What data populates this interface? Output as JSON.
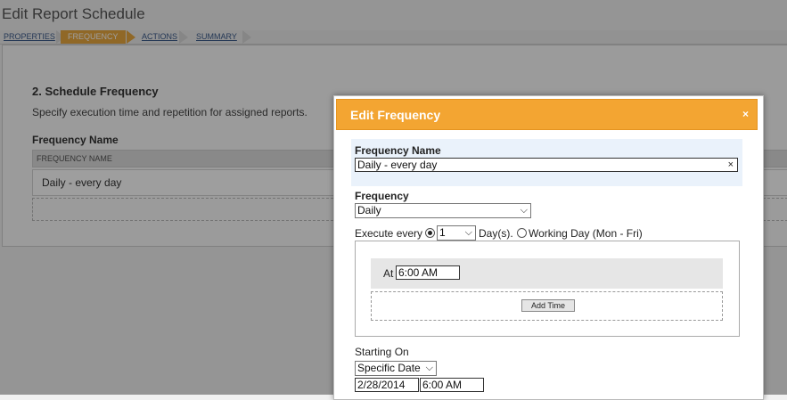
{
  "page": {
    "title": "Edit Report Schedule",
    "steps": [
      "PROPERTIES",
      "FREQUENCY",
      "ACTIONS",
      "SUMMARY"
    ],
    "active_step": "FREQUENCY"
  },
  "background": {
    "section_title": "2. Schedule Frequency",
    "section_description": "Specify execution time and repetition for assigned reports.",
    "frequency_name_label": "Frequency Name",
    "column_header": "FREQUENCY NAME",
    "rows": [
      "Daily - every day"
    ]
  },
  "modal": {
    "title": "Edit Frequency",
    "close_icon": "×",
    "frequency_name_label": "Frequency Name",
    "frequency_name_value": "Daily - every day",
    "clear_icon": "×",
    "frequency_label": "Frequency",
    "frequency_value": "Daily",
    "execute_every_label": "Execute every",
    "execute_every_value": "1",
    "days_label": "Day(s).",
    "working_day_label": "Working Day (Mon - Fri)",
    "execute_every_checked": true,
    "working_day_checked": false,
    "at_label": "At",
    "at_time_value": "6:00 AM",
    "add_time_button": "Add Time",
    "starting_on_label": "Starting On",
    "starting_on_value": "Specific Date",
    "start_date_value": "2/28/2014",
    "start_time_value": "6:00 AM"
  },
  "colors": {
    "accent": "#f3a532",
    "step_active": "#e8a840",
    "highlight_band": "#eaf2fb",
    "link": "#3a5a8a"
  },
  "icons": {
    "close": "close-icon",
    "clear": "clear-icon",
    "dropdown": "chevron-down-icon"
  }
}
